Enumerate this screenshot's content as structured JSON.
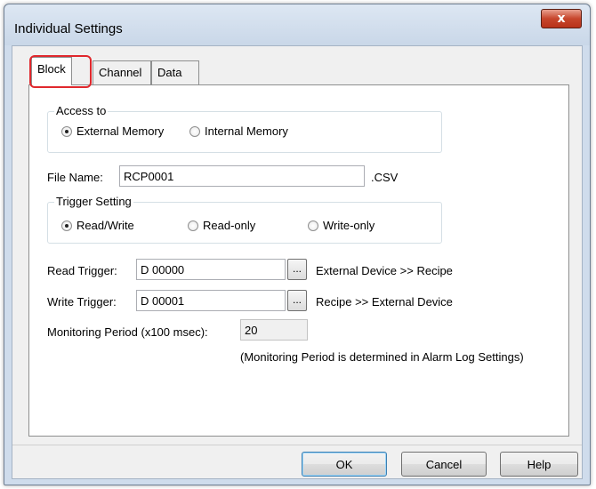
{
  "window": {
    "title": "Individual Settings",
    "close_glyph": "x"
  },
  "tabs": [
    {
      "label": "Block",
      "active": true
    },
    {
      "label": "Channel",
      "active": false
    },
    {
      "label": "Data",
      "active": false
    }
  ],
  "access_to": {
    "legend": "Access to",
    "options": [
      {
        "label": "External Memory",
        "checked": true
      },
      {
        "label": "Internal Memory",
        "checked": false
      }
    ]
  },
  "file_name": {
    "label": "File Name:",
    "value": "RCP0001",
    "extension": ".CSV"
  },
  "trigger_setting": {
    "legend": "Trigger Setting",
    "options": [
      {
        "label": "Read/Write",
        "checked": true
      },
      {
        "label": "Read-only",
        "checked": false
      },
      {
        "label": "Write-only",
        "checked": false
      }
    ]
  },
  "read_trigger": {
    "label": "Read Trigger:",
    "value": "D 00000",
    "browse": "...",
    "description": "External Device >> Recipe"
  },
  "write_trigger": {
    "label": "Write Trigger:",
    "value": "D 00001",
    "browse": "...",
    "description": "Recipe >> External Device"
  },
  "monitoring": {
    "label": "Monitoring Period (x100 msec):",
    "value": "20",
    "note": "(Monitoring Period is determined in Alarm Log Settings)"
  },
  "buttons": {
    "ok": "OK",
    "cancel": "Cancel",
    "help": "Help"
  }
}
